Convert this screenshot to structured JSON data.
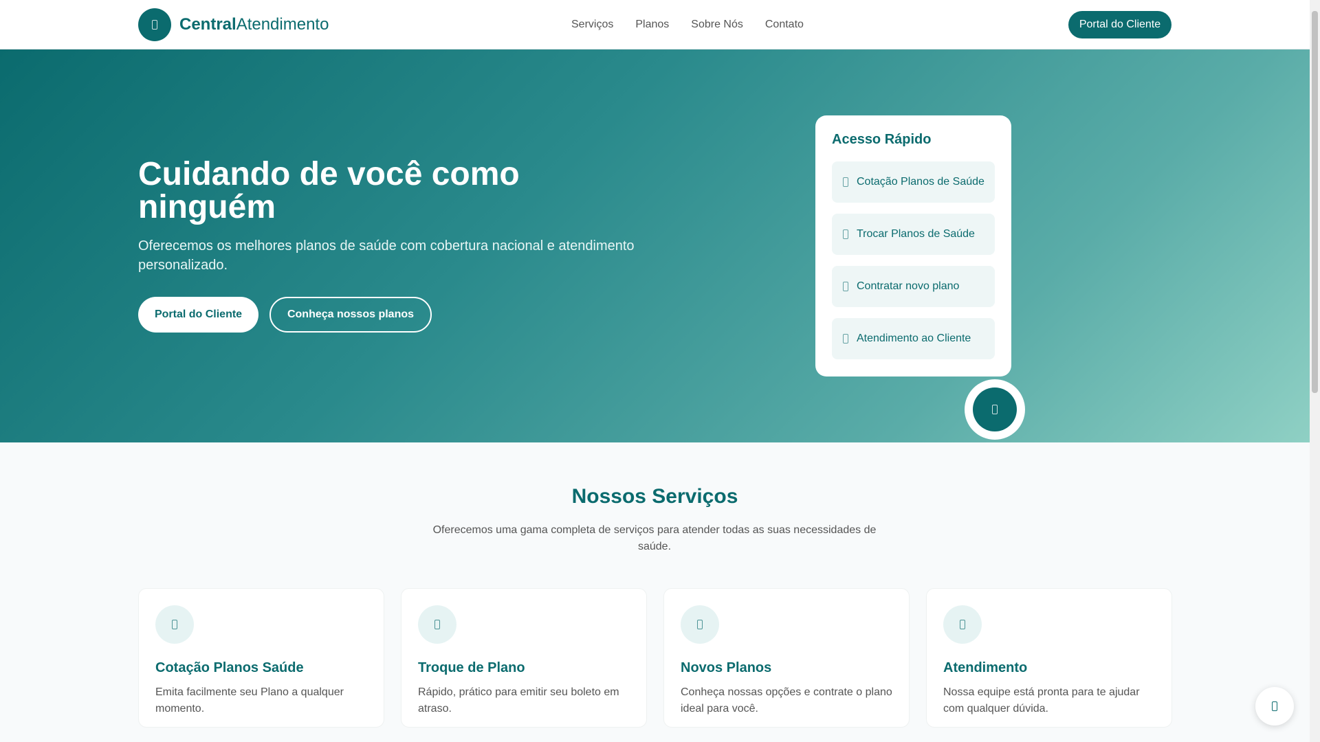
{
  "header": {
    "logo_bold": "Central",
    "logo_rest": "Atendimento",
    "nav": [
      "Serviços",
      "Planos",
      "Sobre Nós",
      "Contato"
    ],
    "portal_label": "Portal do Cliente"
  },
  "hero": {
    "title": "Cuidando de você como ninguém",
    "subtitle": "Oferecemos os melhores planos de saúde com cobertura nacional e atendimento personalizado.",
    "primary_label": "Portal do Cliente",
    "secondary_label": "Conheça nossos planos"
  },
  "quick_access": {
    "title": "Acesso Rápido",
    "items": [
      "Cotação Planos de Saúde",
      "Trocar Planos de Saúde",
      "Contratar novo plano",
      "Atendimento ao Cliente"
    ]
  },
  "services": {
    "title": "Nossos Serviços",
    "subtitle": "Oferecemos uma gama completa de serviços para atender todas as suas necessidades de saúde.",
    "cards": [
      {
        "title": "Cotação Planos Saúde",
        "text": "Emita facilmente seu Plano a qualquer momento."
      },
      {
        "title": "Troque de Plano",
        "text": "Rápido, prático para emitir seu boleto em atraso."
      },
      {
        "title": "Novos Planos",
        "text": "Conheça nossas opções e contrate o plano ideal para você."
      },
      {
        "title": "Atendimento",
        "text": "Nossa equipe está pronta para te ajudar com qualquer dúvida."
      }
    ]
  },
  "colors": {
    "brand": "#0b6b6e"
  }
}
